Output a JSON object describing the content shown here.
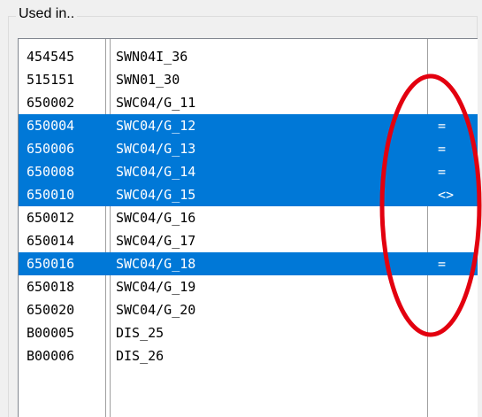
{
  "group": {
    "caption": "Used in.."
  },
  "list": {
    "rows": [
      {
        "code": "454545",
        "name": "SWN04I_36",
        "mark": "",
        "selected": false
      },
      {
        "code": "515151",
        "name": "SWN01_30",
        "mark": "",
        "selected": false
      },
      {
        "code": "650002",
        "name": "SWC04/G_11",
        "mark": "",
        "selected": false
      },
      {
        "code": "650004",
        "name": "SWC04/G_12",
        "mark": "=",
        "selected": true
      },
      {
        "code": "650006",
        "name": "SWC04/G_13",
        "mark": "=",
        "selected": true
      },
      {
        "code": "650008",
        "name": "SWC04/G_14",
        "mark": "=",
        "selected": true
      },
      {
        "code": "650010",
        "name": "SWC04/G_15",
        "mark": "<>",
        "selected": true
      },
      {
        "code": "650012",
        "name": "SWC04/G_16",
        "mark": "",
        "selected": false
      },
      {
        "code": "650014",
        "name": "SWC04/G_17",
        "mark": "",
        "selected": false
      },
      {
        "code": "650016",
        "name": "SWC04/G_18",
        "mark": "=",
        "selected": true
      },
      {
        "code": "650018",
        "name": "SWC04/G_19",
        "mark": "",
        "selected": false
      },
      {
        "code": "650020",
        "name": "SWC04/G_20",
        "mark": "",
        "selected": false
      },
      {
        "code": "B00005",
        "name": "DIS_25",
        "mark": "",
        "selected": false
      },
      {
        "code": "B00006",
        "name": "DIS_26",
        "mark": "",
        "selected": false
      }
    ]
  },
  "colors": {
    "selection": "#0078d7",
    "annotation": "#e3000f"
  }
}
